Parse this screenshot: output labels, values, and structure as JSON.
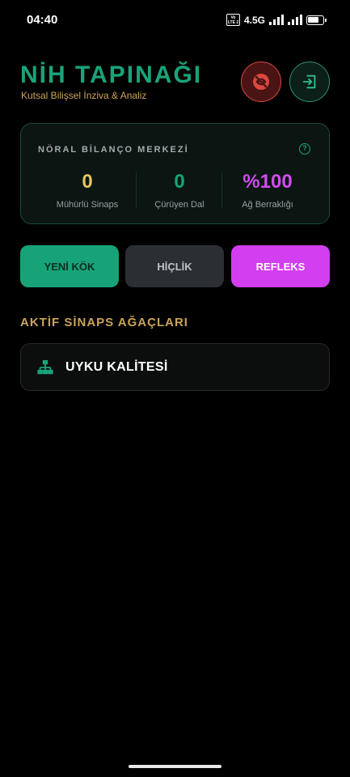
{
  "status_bar": {
    "time": "04:40",
    "volte_line1": "Vo",
    "volte_line2": "LTE 2",
    "network": "4.5G",
    "icons": [
      "volte-icon",
      "signal-icon",
      "signal-icon",
      "battery-icon"
    ]
  },
  "header": {
    "title": "NİH TAPINAĞI",
    "subtitle": "Kutsal Bilişsel İnziva & Analiz",
    "focus_button_icon": "eye-off-icon",
    "exit_button_icon": "logout-icon"
  },
  "balance_card": {
    "title": "NÖRAL BİLANÇO MERKEZİ",
    "help_icon": "help-icon",
    "stats": [
      {
        "value": "0",
        "label": "Mühürlü Sinaps",
        "color": "#e8c35f"
      },
      {
        "value": "0",
        "label": "Çürüyen Dal",
        "color": "#1aa37a"
      },
      {
        "value": "%100",
        "label": "Ağ Berraklığı",
        "color": "#d04ef0"
      }
    ]
  },
  "actions": {
    "new_root": "YENİ KÖK",
    "void": "HİÇLİK",
    "reflex": "REFLEKS"
  },
  "section": {
    "title": "AKTİF SİNAPS AĞAÇLARI"
  },
  "trees": [
    {
      "label": "UYKU KALİTESİ",
      "icon": "sitemap-icon"
    }
  ],
  "colors": {
    "accent_green": "#1aa37a",
    "accent_gold": "#cba35a",
    "accent_magenta": "#d23ef0",
    "danger_red": "#d9473f"
  }
}
